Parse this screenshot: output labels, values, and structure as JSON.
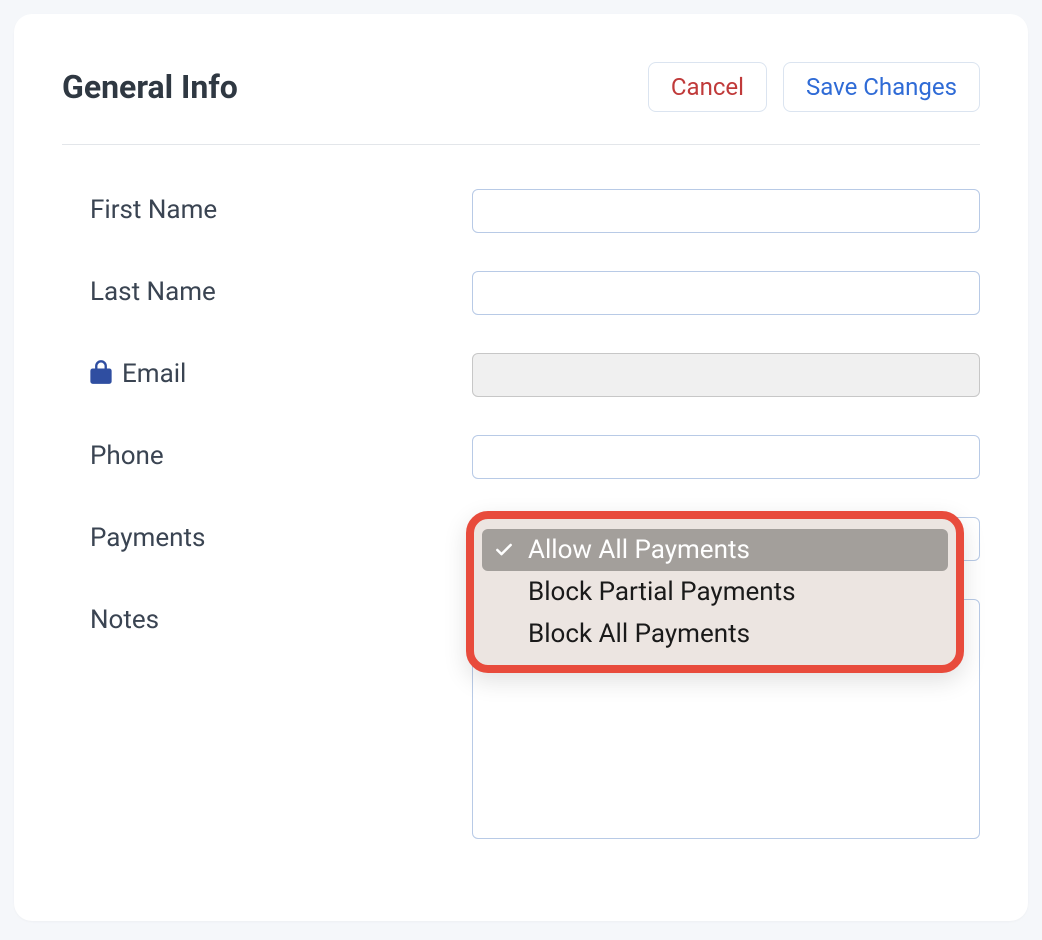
{
  "header": {
    "title": "General Info",
    "cancel_label": "Cancel",
    "save_label": "Save Changes"
  },
  "fields": {
    "first_name": {
      "label": "First Name",
      "value": ""
    },
    "last_name": {
      "label": "Last Name",
      "value": ""
    },
    "email": {
      "label": "Email",
      "value": "",
      "locked": true
    },
    "phone": {
      "label": "Phone",
      "value": ""
    },
    "payments": {
      "label": "Payments"
    },
    "notes": {
      "label": "Notes",
      "value": ""
    }
  },
  "payments_dropdown": {
    "selected_index": 0,
    "options": [
      "Allow All Payments",
      "Block Partial Payments",
      "Block All Payments"
    ]
  },
  "icons": {
    "lock": "lock-icon",
    "check": "check-icon"
  }
}
